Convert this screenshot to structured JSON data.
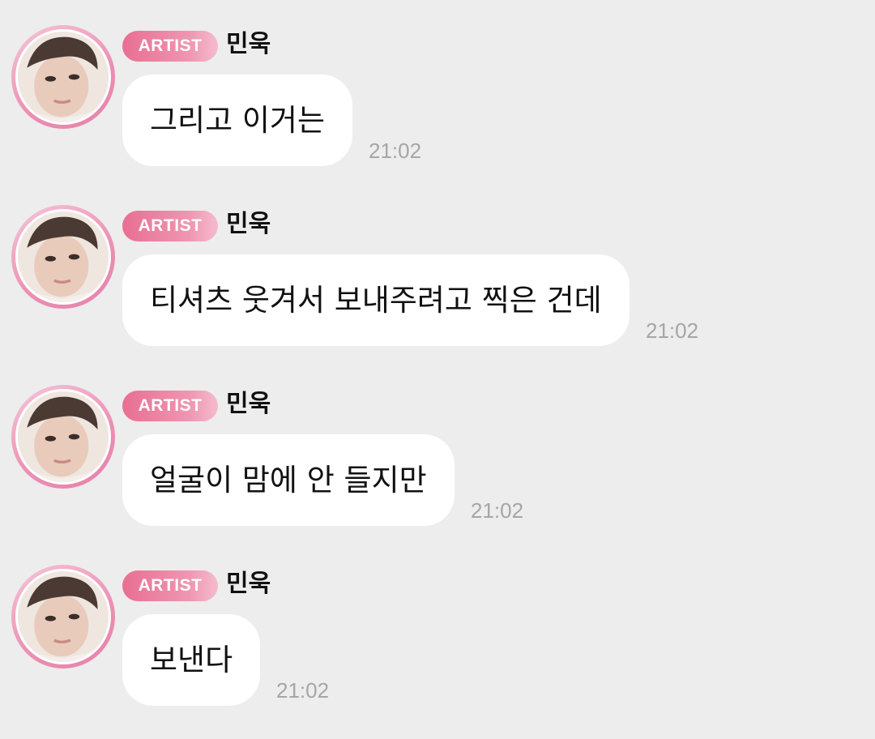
{
  "messages": [
    {
      "badge": "ARTIST",
      "sender": "민욱",
      "text": "그리고 이거는",
      "time": "21:02"
    },
    {
      "badge": "ARTIST",
      "sender": "민욱",
      "text": "티셔츠 웃겨서 보내주려고 찍은 건데",
      "time": "21:02"
    },
    {
      "badge": "ARTIST",
      "sender": "민욱",
      "text": "얼굴이 맘에 안 들지만",
      "time": "21:02"
    },
    {
      "badge": "ARTIST",
      "sender": "민욱",
      "text": "보낸다",
      "time": "21:02"
    }
  ],
  "colors": {
    "background": "#ededed",
    "bubble": "#ffffff",
    "badge_start": "#e86f92",
    "badge_end": "#f5bccd",
    "avatar_ring": "#ec8fb3",
    "timestamp": "#a6a6a6"
  },
  "icons": {
    "avatar": "profile-photo"
  }
}
